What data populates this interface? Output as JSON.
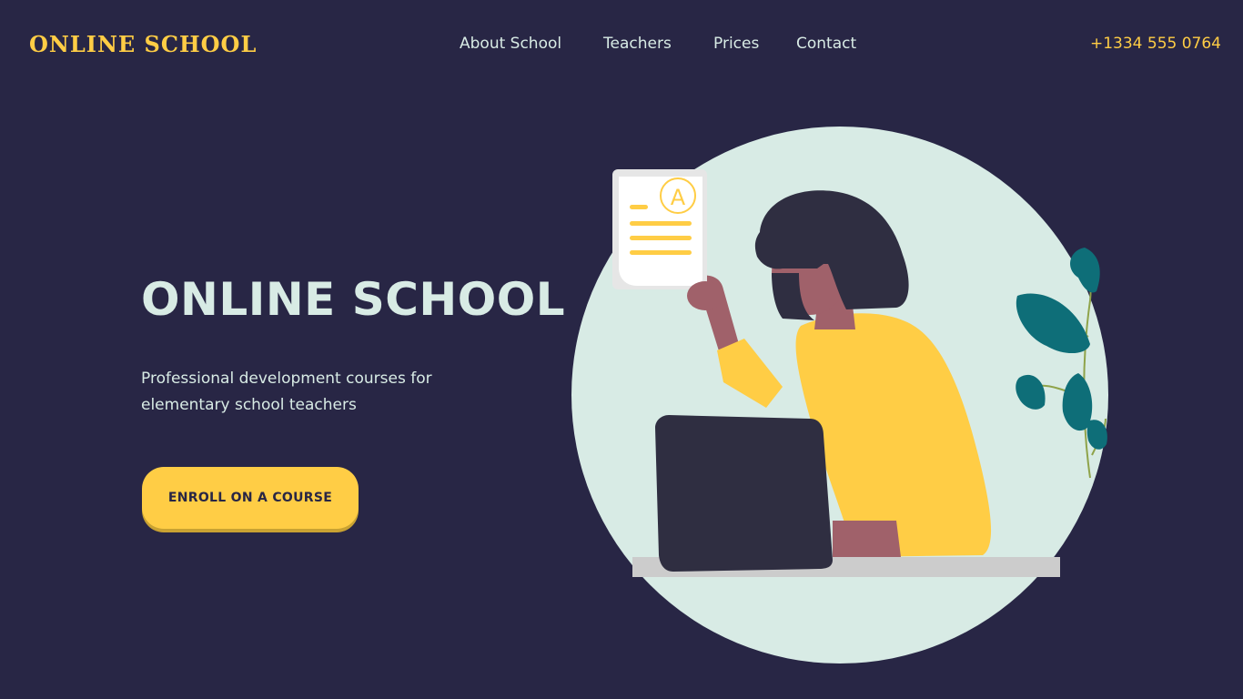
{
  "header": {
    "logo": "ONLINE SCHOOL",
    "nav": [
      {
        "label": "About School"
      },
      {
        "label": "Teachers"
      },
      {
        "label": "Prices"
      },
      {
        "label": "Contact"
      }
    ],
    "phone": "+1334 555 0764"
  },
  "hero": {
    "title": "ONLINE SCHOOL",
    "subtitle": "Professional development courses for elementary school teachers",
    "cta_label": "ENROLL ON A COURSE"
  },
  "illustration": {
    "paper_grade": "A"
  },
  "colors": {
    "background": "#282645",
    "accent": "#ffcd45",
    "text_light": "#d8ebe5",
    "circle": "#d8ebe5",
    "plant": "#0e6e78"
  }
}
